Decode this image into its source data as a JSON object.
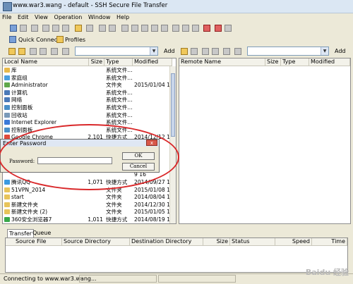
{
  "window": {
    "title": "www.war3.wang - default - SSH Secure File Transfer"
  },
  "menu": [
    "File",
    "Edit",
    "View",
    "Operation",
    "Window",
    "Help"
  ],
  "toolbar2": {
    "quick_connect": "Quick Connect",
    "profiles": "Profiles"
  },
  "local": {
    "add_label": "Add",
    "columns": [
      "Local Name",
      "Size",
      "Type",
      "Modified"
    ],
    "rows": [
      {
        "name": "库",
        "size": "",
        "type": "系统文件...",
        "modified": "",
        "color": "#e8b94a"
      },
      {
        "name": "家庭组",
        "size": "",
        "type": "系统文件...",
        "modified": "",
        "color": "#4aa0e0"
      },
      {
        "name": "Administrator",
        "size": "",
        "type": "文件夹",
        "modified": "2015/01/04 14",
        "color": "#5fa84a"
      },
      {
        "name": "计算机",
        "size": "",
        "type": "系统文件...",
        "modified": "",
        "color": "#4a7ab8"
      },
      {
        "name": "网络",
        "size": "",
        "type": "系统文件...",
        "modified": "",
        "color": "#4a7ab8"
      },
      {
        "name": "控制面板",
        "size": "",
        "type": "系统文件...",
        "modified": "",
        "color": "#4a90c8"
      },
      {
        "name": "回收站",
        "size": "",
        "type": "系统文件...",
        "modified": "",
        "color": "#7a9ab8"
      },
      {
        "name": "Internet Explorer",
        "size": "",
        "type": "系统文件...",
        "modified": "",
        "color": "#3a7ad8"
      },
      {
        "name": "控制面板",
        "size": "",
        "type": "系统文件...",
        "modified": "",
        "color": "#4a90c8"
      },
      {
        "name": "Google Chrome",
        "size": "2,101",
        "type": "快捷方式",
        "modified": "2014/12/12 10",
        "color": "#e04a3a"
      },
      {
        "name": "",
        "size": "",
        "type": "",
        "modified": "",
        "color": ""
      },
      {
        "name": "",
        "size": "",
        "type": "",
        "modified": "9 16",
        "color": ""
      },
      {
        "name": "",
        "size": "",
        "type": "",
        "modified": "9 16",
        "color": ""
      },
      {
        "name": "",
        "size": "",
        "type": "",
        "modified": "9 16",
        "color": ""
      },
      {
        "name": "",
        "size": "",
        "type": "",
        "modified": "9 16",
        "color": ""
      },
      {
        "name": "腾讯QQ",
        "size": "1,071",
        "type": "快捷方式",
        "modified": "2014/09/27 15",
        "color": "#3a9ae0"
      },
      {
        "name": "51VPN_2014",
        "size": "",
        "type": "文件夹",
        "modified": "2015/01/08 13",
        "color": "#e8c45a"
      },
      {
        "name": "start",
        "size": "",
        "type": "文件夹",
        "modified": "2014/08/04 14",
        "color": "#e8c45a"
      },
      {
        "name": "新建文件夹",
        "size": "",
        "type": "文件夹",
        "modified": "2014/12/30 14",
        "color": "#e8c45a"
      },
      {
        "name": "新建文件夹 (2)",
        "size": "",
        "type": "文件夹",
        "modified": "2015/01/05 13",
        "color": "#e8c45a"
      },
      {
        "name": "360安全浏览器7",
        "size": "1,011",
        "type": "快捷方式",
        "modified": "2014/08/19 15",
        "color": "#3aa84a"
      }
    ]
  },
  "remote": {
    "add_label": "Add",
    "columns": [
      "Remote Name",
      "Size",
      "Type",
      "Modified"
    ]
  },
  "dialog": {
    "title": "Enter Password",
    "password_label": "Password:",
    "ok_label": "OK",
    "cancel_label": "Cancel",
    "close_glyph": "x"
  },
  "transfer": {
    "tabs": [
      "Transfer",
      "Queue"
    ],
    "columns": [
      "Source File",
      "Source Directory",
      "Destination Directory",
      "Size",
      "Status",
      "Speed",
      "Time"
    ]
  },
  "status": {
    "text": "Connecting to www.war3.wang..."
  },
  "watermark": "Baidu 经验",
  "colors": {
    "highlight_ellipse": "#d9282a",
    "titlebar": "#dbe7f3"
  }
}
